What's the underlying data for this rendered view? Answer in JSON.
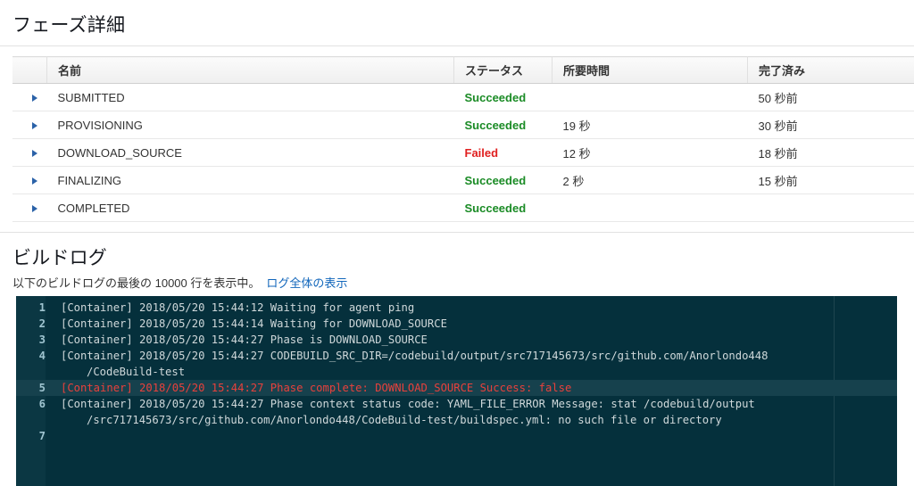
{
  "phase_section": {
    "title": "フェーズ詳細",
    "columns": [
      "",
      "名前",
      "ステータス",
      "所要時間",
      "完了済み"
    ],
    "rows": [
      {
        "name": "SUBMITTED",
        "status": "Succeeded",
        "status_kind": "succeeded",
        "duration": "",
        "completed": "50 秒前"
      },
      {
        "name": "PROVISIONING",
        "status": "Succeeded",
        "status_kind": "succeeded",
        "duration": "19 秒",
        "completed": "30 秒前"
      },
      {
        "name": "DOWNLOAD_SOURCE",
        "status": "Failed",
        "status_kind": "failed",
        "duration": "12 秒",
        "completed": "18 秒前"
      },
      {
        "name": "FINALIZING",
        "status": "Succeeded",
        "status_kind": "succeeded",
        "duration": "2 秒",
        "completed": "15 秒前"
      },
      {
        "name": "COMPLETED",
        "status": "Succeeded",
        "status_kind": "succeeded",
        "duration": "",
        "completed": ""
      }
    ]
  },
  "log_section": {
    "title": "ビルドログ",
    "subtitle": "以下のビルドログの最後の 10000 行を表示中。",
    "full_log_link": "ログ全体の表示",
    "lines": [
      {
        "n": "1",
        "text": "[Container] 2018/05/20 15:44:12 Waiting for agent ping",
        "error": false,
        "highlight": false,
        "cont": ""
      },
      {
        "n": "2",
        "text": "[Container] 2018/05/20 15:44:14 Waiting for DOWNLOAD_SOURCE",
        "error": false,
        "highlight": false,
        "cont": ""
      },
      {
        "n": "3",
        "text": "[Container] 2018/05/20 15:44:27 Phase is DOWNLOAD_SOURCE",
        "error": false,
        "highlight": false,
        "cont": ""
      },
      {
        "n": "4",
        "text": "[Container] 2018/05/20 15:44:27 CODEBUILD_SRC_DIR=/codebuild/output/src717145673/src/github.com/Anorlondo448",
        "error": false,
        "highlight": false,
        "cont": "/CodeBuild-test"
      },
      {
        "n": "5",
        "text": "[Container] 2018/05/20 15:44:27 Phase complete: DOWNLOAD_SOURCE Success: false",
        "error": true,
        "highlight": true,
        "cont": ""
      },
      {
        "n": "6",
        "text": "[Container] 2018/05/20 15:44:27 Phase context status code: YAML_FILE_ERROR Message: stat /codebuild/output",
        "error": false,
        "highlight": false,
        "cont": "/src717145673/src/github.com/Anorlondo448/CodeBuild-test/buildspec.yml: no such file or directory"
      },
      {
        "n": "7",
        "text": "",
        "error": false,
        "highlight": false,
        "cont": ""
      }
    ]
  },
  "colors": {
    "succeeded": "#1a8b25",
    "failed": "#e02020",
    "link": "#1166bb",
    "log_bg": "#05303c",
    "log_gutter": "#0b3743",
    "log_highlight": "#16414d"
  }
}
